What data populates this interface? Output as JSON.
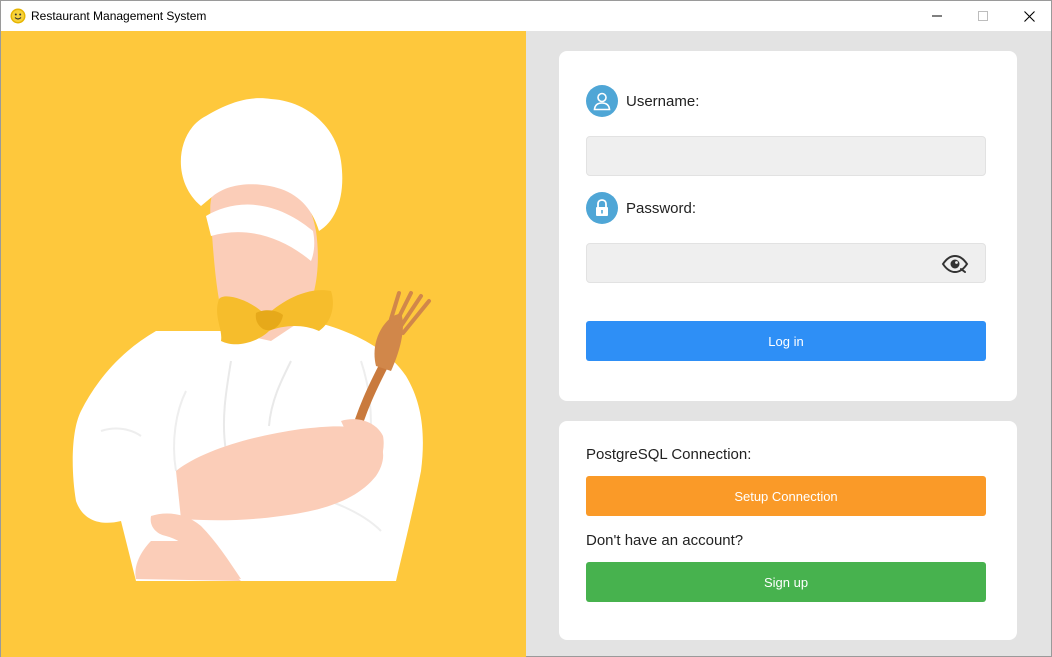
{
  "window": {
    "title": "Restaurant Management System",
    "controls": {
      "minimize": "minimize-icon",
      "maximize": "maximize-icon",
      "close": "close-icon"
    }
  },
  "colors": {
    "hero_bg": "#fec83c",
    "login_button": "#2e8ff6",
    "setup_button": "#fa9a28",
    "signup_button": "#47b24e",
    "field_icon": "#4fa6d6"
  },
  "login": {
    "username_label": "Username:",
    "username_value": "",
    "username_icon": "user-icon",
    "password_label": "Password:",
    "password_value": "",
    "password_icon": "lock-icon",
    "toggle_icon": "eye-icon",
    "login_button": "Log in"
  },
  "connection": {
    "label": "PostgreSQL Connection:",
    "setup_button": "Setup Connection"
  },
  "signup": {
    "prompt": "Don't have an account?",
    "button": "Sign up"
  },
  "hero": {
    "illustration": "chef-illustration"
  }
}
